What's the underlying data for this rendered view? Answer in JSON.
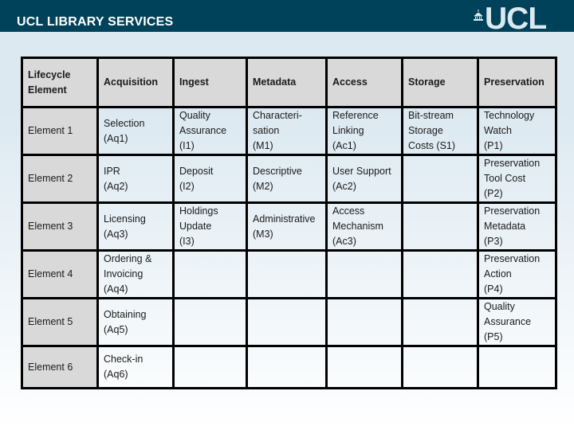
{
  "header": {
    "title": "UCL LIBRARY SERVICES",
    "logo_text": "UCL",
    "logo_icon": "dome-icon",
    "bar_color": "#00425a"
  },
  "table": {
    "columns": [
      "Lifecycle Element",
      "Acquisition",
      "Ingest",
      "Metadata",
      "Access",
      "Storage",
      "Preservation"
    ],
    "rows": [
      {
        "label": "Element 1",
        "cells": [
          [
            "Selection",
            "(Aq1)"
          ],
          [
            "Quality",
            "Assurance",
            "(I1)"
          ],
          [
            "Characteri-",
            "sation",
            "(M1)"
          ],
          [
            "Reference",
            "Linking",
            "(Ac1)"
          ],
          [
            "Bit-stream",
            "Storage",
            "Costs (S1)"
          ],
          [
            "Technology",
            "Watch",
            "(P1)"
          ]
        ]
      },
      {
        "label": "Element 2",
        "cells": [
          [
            "IPR",
            "(Aq2)"
          ],
          [
            "Deposit",
            "(I2)"
          ],
          [
            "Descriptive",
            "(M2)"
          ],
          [
            "User Support",
            "(Ac2)"
          ],
          [],
          [
            "Preservation",
            "Tool Cost",
            "(P2)"
          ]
        ]
      },
      {
        "label": "Element 3",
        "cells": [
          [
            "Licensing",
            "(Aq3)"
          ],
          [
            "Holdings",
            "Update",
            "(I3)"
          ],
          [
            "Administrative",
            "(M3)"
          ],
          [
            "Access",
            "Mechanism",
            "(Ac3)"
          ],
          [],
          [
            "Preservation",
            "Metadata",
            "(P3)"
          ]
        ]
      },
      {
        "label": "Element 4",
        "cells": [
          [
            "Ordering &",
            "Invoicing",
            "(Aq4)"
          ],
          [],
          [],
          [],
          [],
          [
            "Preservation",
            "Action",
            "(P4)"
          ]
        ]
      },
      {
        "label": "Element 5",
        "cells": [
          [
            "Obtaining",
            "(Aq5)"
          ],
          [],
          [],
          [],
          [],
          [
            "Quality",
            "Assurance",
            "(P5)"
          ]
        ]
      },
      {
        "label": "Element 6",
        "cells": [
          [
            "Check-in",
            "(Aq6)"
          ],
          [],
          [],
          [],
          [],
          []
        ]
      }
    ]
  }
}
